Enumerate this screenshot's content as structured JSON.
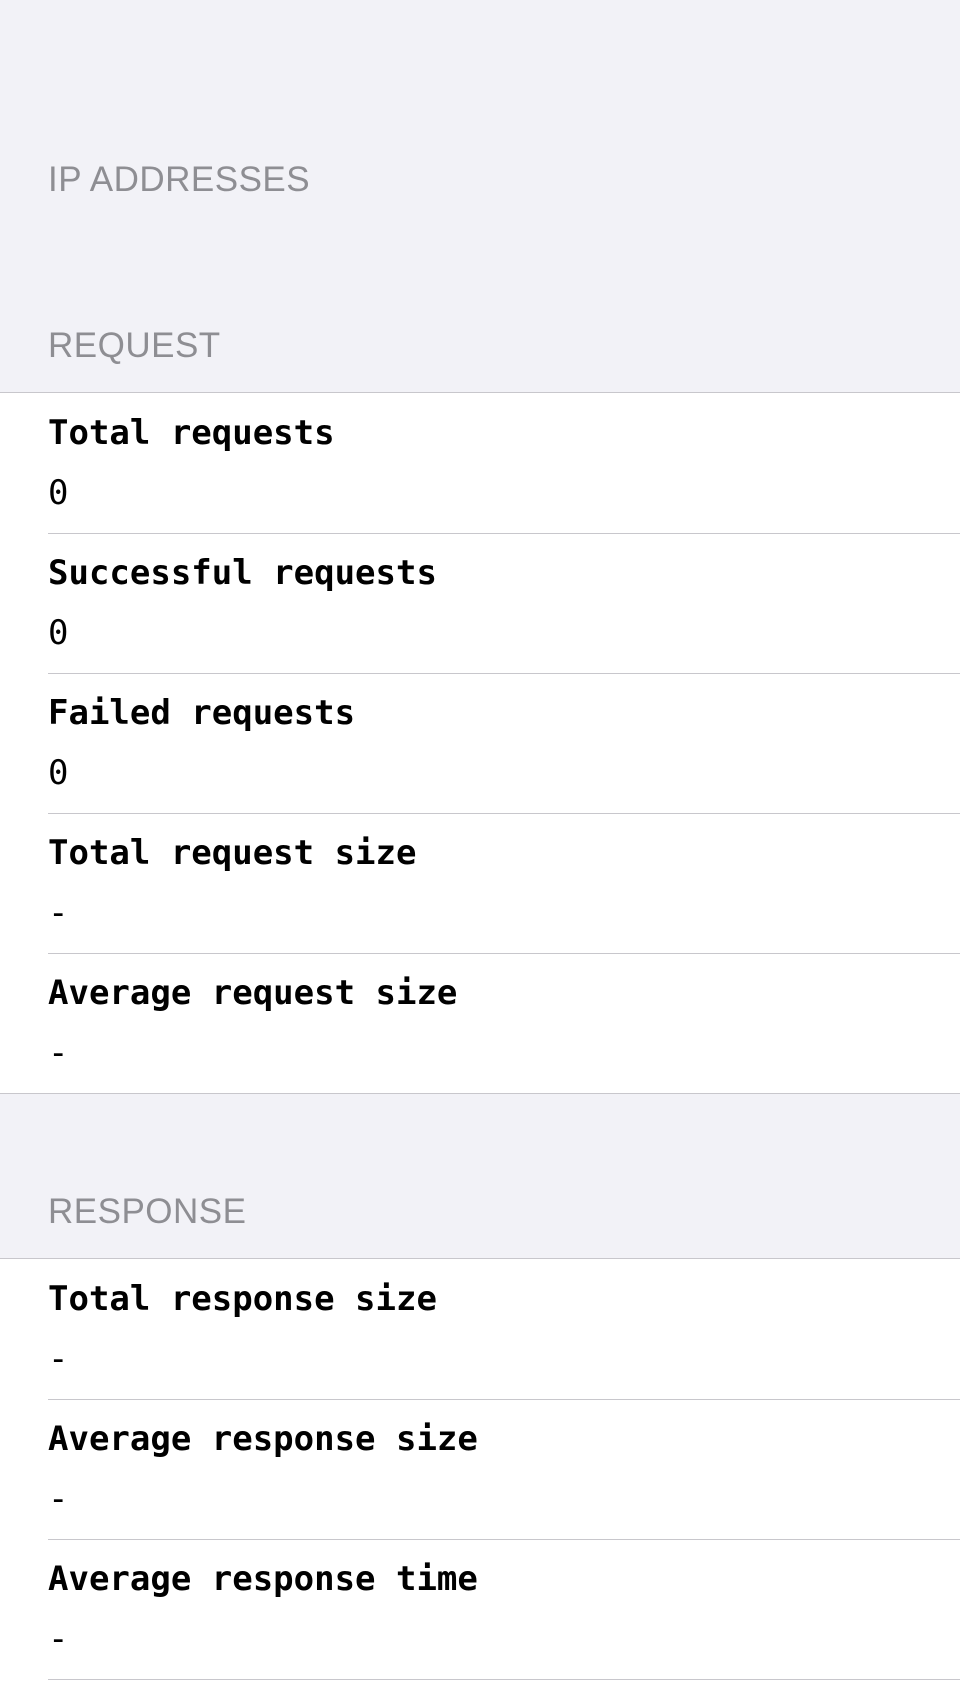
{
  "sections": {
    "ip_addresses": {
      "header": "IP ADDRESSES"
    },
    "request": {
      "header": "REQUEST",
      "rows": [
        {
          "title": "Total requests",
          "value": "0"
        },
        {
          "title": "Successful requests",
          "value": "0"
        },
        {
          "title": "Failed requests",
          "value": "0"
        },
        {
          "title": "Total request size",
          "value": "-"
        },
        {
          "title": "Average request size",
          "value": "-"
        }
      ]
    },
    "response": {
      "header": "RESPONSE",
      "rows": [
        {
          "title": "Total response size",
          "value": "-"
        },
        {
          "title": "Average response size",
          "value": "-"
        },
        {
          "title": "Average response time",
          "value": "-"
        }
      ]
    }
  },
  "colors": {
    "background": "#f2f2f7",
    "cell": "#ffffff",
    "header_text": "#8e8e93",
    "separator": "#c8c7cc"
  }
}
